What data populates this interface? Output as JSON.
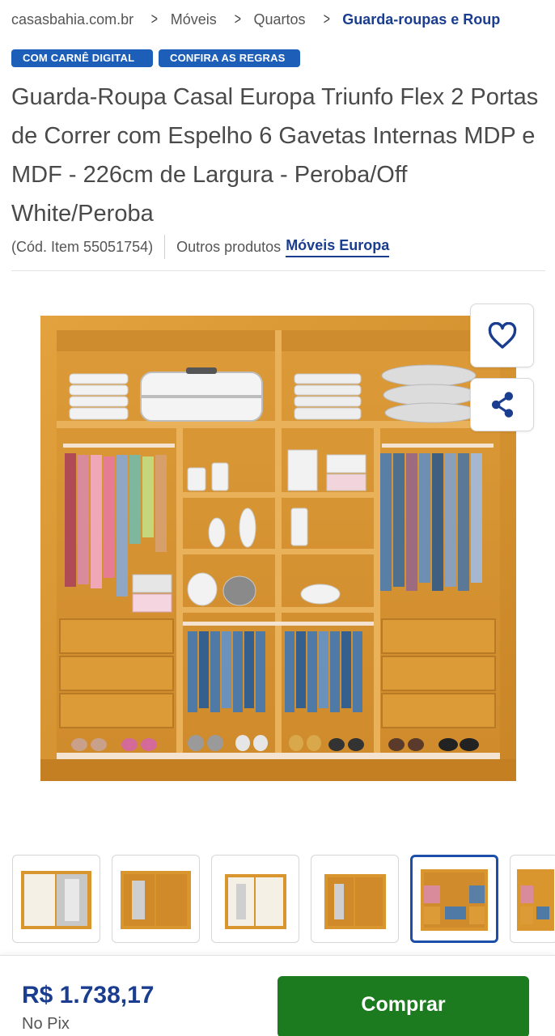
{
  "breadcrumb": {
    "items": [
      "casasbahia.com.br",
      "Móveis",
      "Quartos",
      "Guarda-roupas e Roup"
    ]
  },
  "badges": [
    "COM CARNÊ DIGITAL",
    "CONFIRA AS REGRAS"
  ],
  "product": {
    "title": "Guarda-Roupa Casal Europa Triunfo Flex 2 Portas de Correr com Espelho 6 Gavetas Internas MDP e MDF - 226cm de Largura - Peroba/Off White/Peroba",
    "code": "(Cód. Item 55051754)",
    "others_label": "Outros produtos",
    "brand": "Móveis Europa"
  },
  "icons": {
    "favorite": "heart-icon",
    "share": "share-icon"
  },
  "colors": {
    "brand_blue": "#1a3d8f",
    "badge_blue": "#1d5fb8",
    "buy_green": "#1c7a1f",
    "wood": "#d9952e"
  },
  "gallery": {
    "thumbnail_count": 6,
    "active_index": 4
  },
  "purchase": {
    "price": "R$ 1.738,17",
    "price_note": "No Pix",
    "buy_label": "Comprar"
  }
}
